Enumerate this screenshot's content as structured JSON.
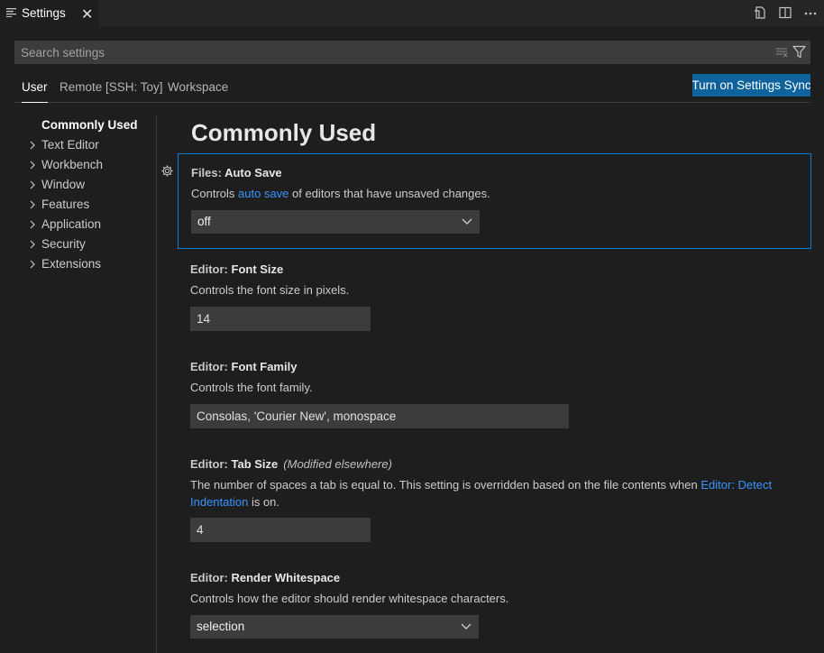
{
  "tab": {
    "title": "Settings",
    "close_glyph": "✕"
  },
  "search": {
    "placeholder": "Search settings",
    "value": ""
  },
  "scopes": [
    {
      "label": "User",
      "active": true
    },
    {
      "label": "Remote [SSH: Toy]",
      "active": false
    },
    {
      "label": "Workspace",
      "active": false
    }
  ],
  "sync_button": "Turn on Settings Sync",
  "toc": [
    {
      "label": "Commonly Used",
      "selected": true
    },
    {
      "label": "Text Editor"
    },
    {
      "label": "Workbench"
    },
    {
      "label": "Window"
    },
    {
      "label": "Features"
    },
    {
      "label": "Application"
    },
    {
      "label": "Security"
    },
    {
      "label": "Extensions"
    }
  ],
  "section_title": "Commonly Used",
  "settings": {
    "auto_save": {
      "category": "Files: ",
      "name": "Auto Save",
      "desc_pre": "Controls ",
      "desc_link": "auto save",
      "desc_post": " of editors that have unsaved changes.",
      "value": "off"
    },
    "font_size": {
      "category": "Editor: ",
      "name": "Font Size",
      "desc": "Controls the font size in pixels.",
      "value": "14"
    },
    "font_family": {
      "category": "Editor: ",
      "name": "Font Family",
      "desc": "Controls the font family.",
      "value": "Consolas, 'Courier New', monospace"
    },
    "tab_size": {
      "category": "Editor: ",
      "name": "Tab Size",
      "modified": "(Modified elsewhere)",
      "desc_pre": "The number of spaces a tab is equal to. This setting is overridden based on the file contents when ",
      "desc_link": "Editor: Detect Indentation",
      "desc_post": " is on.",
      "value": "4"
    },
    "render_whitespace": {
      "category": "Editor: ",
      "name": "Render Whitespace",
      "desc": "Controls how the editor should render whitespace characters.",
      "value": "selection"
    }
  },
  "colors": {
    "accent": "#0e639c",
    "link": "#3794ff",
    "focus_border": "#007fd4"
  }
}
